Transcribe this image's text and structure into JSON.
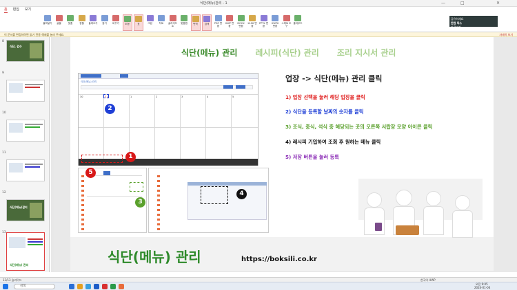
{
  "window": {
    "title": "식단(메뉴)관리 - 1",
    "page_label": "2560x1440"
  },
  "menu": {
    "items": [
      "홈",
      "편집",
      "보기"
    ]
  },
  "ribbon": {
    "buttons": [
      "붙여넣기",
      "글꼴",
      "맞춤",
      "정렬",
      "들여쓰기",
      "찾기",
      "바꾸기",
      "도형",
      "표",
      "그림",
      "차트",
      "슬라이드 쇼",
      "맞춤법",
      "번역",
      "검색",
      "PDF 변환",
      "HWP 변환",
      "DOCX 변환",
      "XLSX 변환",
      "PPTX 변환",
      "HWPX 변환",
      "스마트 도구",
      "클라우드"
    ]
  },
  "ad": {
    "line1": "공유하세요",
    "line2": "한컴 독스",
    "line3": "바로가기"
  },
  "notice": {
    "text": "이 문서를 편집하려면 읽기 전용 해제를 눌러 주세요.",
    "right": "자세히 보기"
  },
  "thumbnails": {
    "numbers": [
      "8",
      "9",
      "10",
      "11",
      "12",
      "13"
    ]
  },
  "slide": {
    "tabs": [
      "식단(메뉴) 관리",
      "레시피(식단) 관리",
      "조리 지시서 관리"
    ],
    "heading": "업장 -> 식단(메뉴) 관리 클릭",
    "steps": [
      "1) 업장 선택을 눌러 해당 업장을 클릭",
      "2) 식단을 등록할 날짜의 숫자를 클릭",
      "3) 조식, 중식, 석식 중 해당되는 곳의 오른쪽 서랍장 모양 아이콘 클릭",
      "4) 레시피 기입하여 조회 후 원하는 메뉴 클릭",
      "5) 저장 버튼을 눌러 등록"
    ],
    "markers": [
      "1",
      "2",
      "3",
      "4",
      "5"
    ],
    "big_title": "식단(메뉴) 관리",
    "url": "https://boksili.co.kr",
    "shot_header": "식단(메뉴) 관리",
    "calendar_days": [
      "30",
      "31",
      "1",
      "2",
      "3",
      "4",
      "5",
      "6"
    ]
  },
  "statusbar": {
    "left": "13/13 슬라이드",
    "right": "한국어 HWP"
  },
  "taskbar": {
    "search": "검색",
    "time": "오전 9:05",
    "date": "2024-01-04"
  },
  "colors": {
    "step1": "#e02020",
    "step2": "#1f3fd6",
    "step3": "#5aa02c",
    "step4": "#111111",
    "step5": "#8a2bb5",
    "marker1": "#d81818",
    "marker2": "#1f3fd6",
    "marker3": "#5aa02c",
    "marker4": "#111111",
    "marker5": "#d81818",
    "accent": "#3a8a2a"
  }
}
